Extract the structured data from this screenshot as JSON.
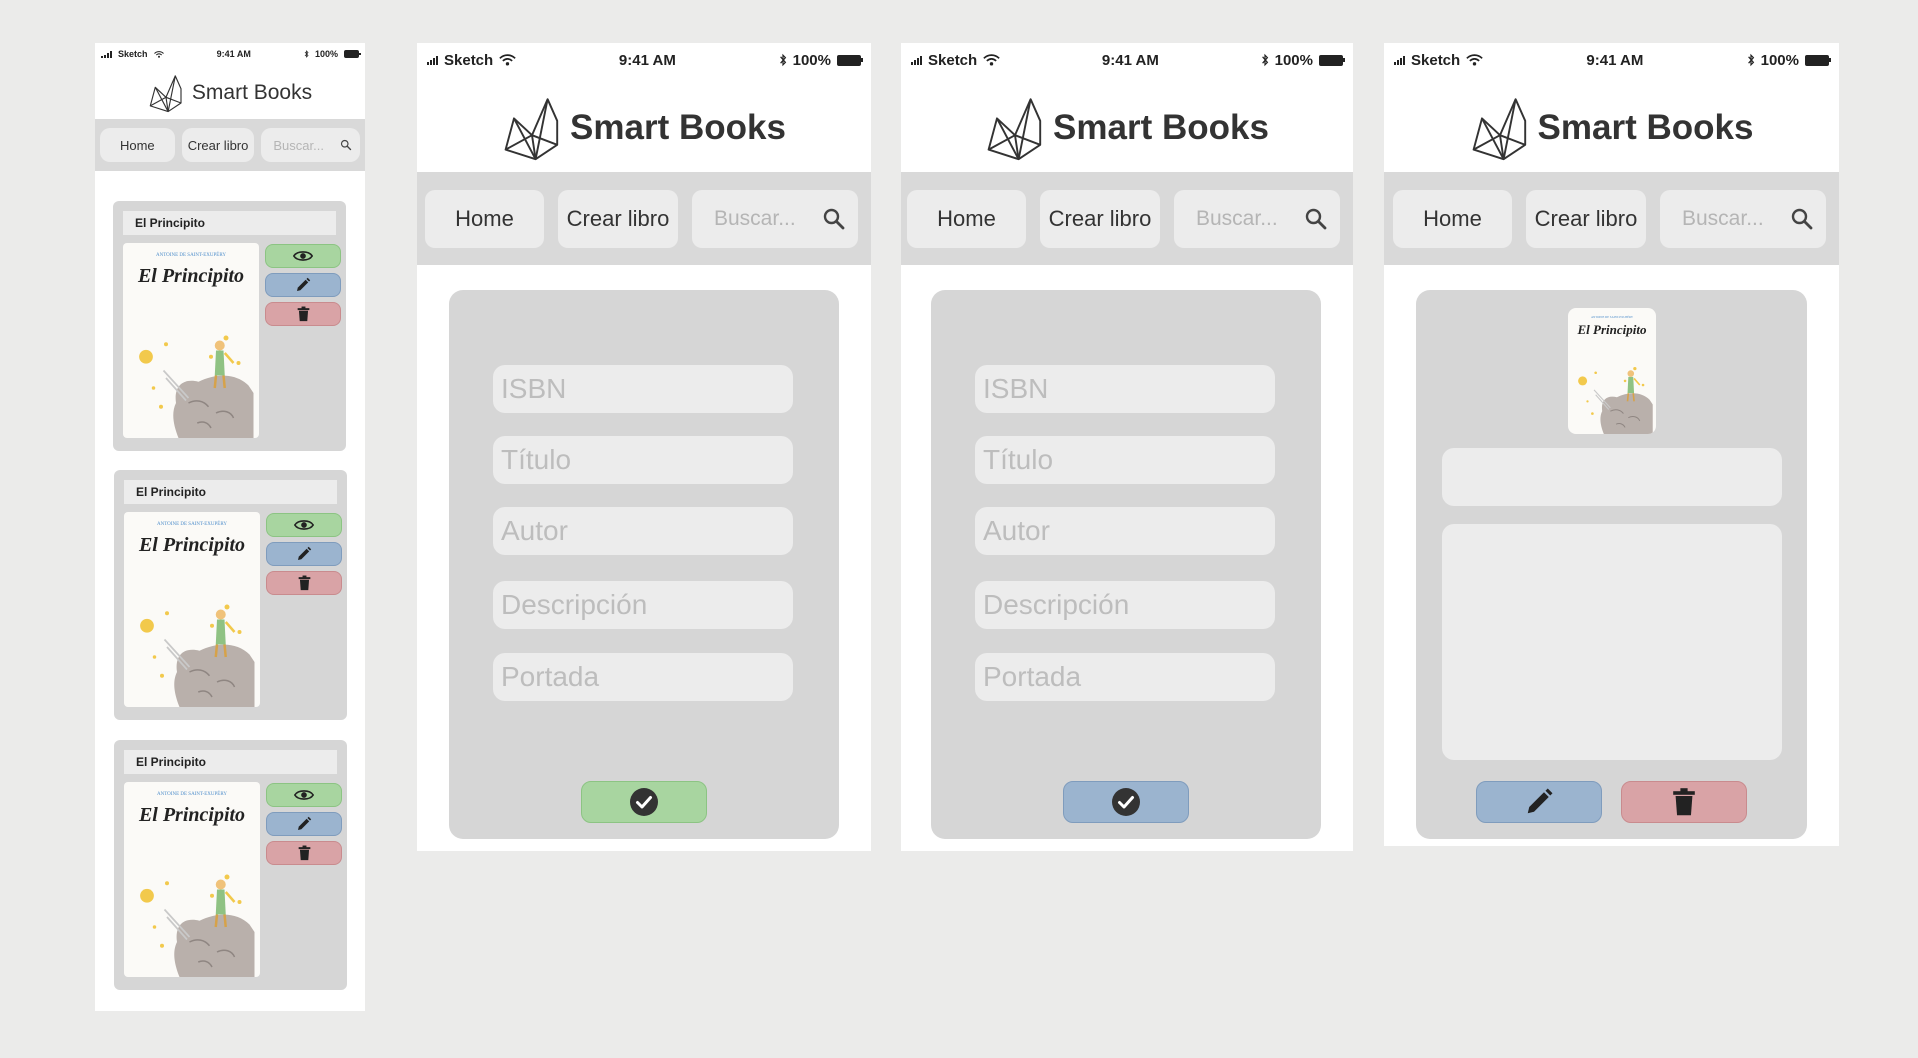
{
  "app": {
    "brand_name": "Smart Books",
    "status_carrier": "Sketch",
    "status_time": "9:41 AM",
    "status_battery_small": "100%",
    "status_battery": "100%"
  },
  "nav": {
    "home_label": "Home",
    "create_label": "Crear libro",
    "search_placeholder": "Buscar..."
  },
  "list_screen": {
    "books": [
      {
        "title": "El Principito",
        "cover_title": "El Principito",
        "cover_author": "ANTOINE DE SAINT-EXUPÉRY"
      },
      {
        "title": "El Principito",
        "cover_title": "El Principito",
        "cover_author": "ANTOINE DE SAINT-EXUPÉRY"
      },
      {
        "title": "El Principito",
        "cover_title": "El Principito",
        "cover_author": "ANTOINE DE SAINT-EXUPÉRY"
      }
    ]
  },
  "create_form": {
    "isbn_placeholder": "ISBN",
    "title_placeholder": "Título",
    "author_placeholder": "Autor",
    "description_placeholder": "Descripción",
    "cover_placeholder": "Portada"
  },
  "detail_screen": {
    "cover_title": "El Principito",
    "cover_author": "ANTOINE DE SAINT-EXUPÉRY"
  },
  "icons": {
    "view": "eye-icon",
    "edit": "pencil-icon",
    "delete": "trash-icon",
    "confirm": "check-circle-icon",
    "search": "search-icon",
    "logo": "crown-logo-icon"
  },
  "colors": {
    "view_button": "#a8d5a0",
    "edit_button": "#9bb4cf",
    "delete_button": "#d9a3a6",
    "panel": "#d6d6d6",
    "field": "#ececec"
  }
}
